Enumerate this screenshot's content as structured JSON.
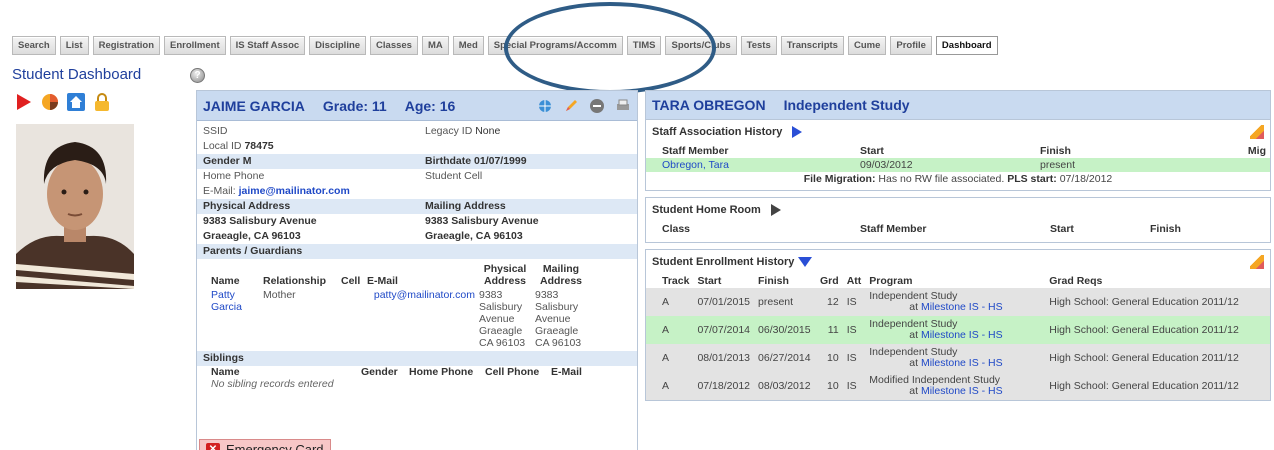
{
  "tabs": [
    {
      "label": "Search"
    },
    {
      "label": "List"
    },
    {
      "label": "Registration"
    },
    {
      "label": "Enrollment"
    },
    {
      "label": "IS Staff Assoc"
    },
    {
      "label": "Discipline"
    },
    {
      "label": "Classes"
    },
    {
      "label": "MA"
    },
    {
      "label": "Med"
    },
    {
      "label": "Special Programs/Accomm"
    },
    {
      "label": "TIMS"
    },
    {
      "label": "Sports/Clubs"
    },
    {
      "label": "Tests"
    },
    {
      "label": "Transcripts"
    },
    {
      "label": "Cume"
    },
    {
      "label": "Profile"
    },
    {
      "label": "Dashboard",
      "active": true
    }
  ],
  "page": {
    "title": "Student Dashboard"
  },
  "student": {
    "name": "JAIME GARCIA",
    "grade": "Grade: 11",
    "age": "Age: 16",
    "ssid_label": "SSID",
    "legacy_label": "Legacy ID",
    "legacy_value": "None",
    "local_label": "Local ID",
    "local_value": "78475",
    "gender_label": "Gender",
    "gender_value": "M",
    "birth_label": "Birthdate",
    "birth_value": "01/07/1999",
    "home_phone_label": "Home Phone",
    "cell_label": "Student Cell",
    "email_label": "E-Mail:",
    "email_value": "jaime@mailinator.com",
    "physical_label": "Physical Address",
    "mailing_label": "Mailing Address",
    "physical_line1": "9383 Salisbury Avenue",
    "physical_line2": "Graeagle, CA 96103",
    "mailing_line1": "9383 Salisbury Avenue",
    "mailing_line2": "Graeagle, CA 96103",
    "parents_label": "Parents / Guardians",
    "guardian_headers": {
      "name": "Name",
      "relationship": "Relationship",
      "cell": "Cell",
      "email": "E-Mail",
      "physical": "Physical Address",
      "mailing": "Mailing Address"
    },
    "guardian": {
      "name": "Patty Garcia",
      "relationship": "Mother",
      "email": "patty@mailinator.com",
      "physical": "9383 Salisbury Avenue Graeagle CA 96103",
      "mailing": "9383 Salisbury Avenue Graeagle CA 96103"
    },
    "siblings_label": "Siblings",
    "sibling_headers": {
      "name": "Name",
      "gender": "Gender",
      "home_phone": "Home Phone",
      "cell": "Cell Phone",
      "email": "E-Mail"
    },
    "sibling_empty": "No sibling records entered",
    "emergency_label": "Emergency Card"
  },
  "teacher": {
    "name": "TARA OBREGON",
    "program": "Independent Study"
  },
  "staff_assoc": {
    "title": "Staff Association History",
    "headers": [
      "Staff Member",
      "Start",
      "Finish",
      "Mig"
    ],
    "row": {
      "member": "Obregon, Tara",
      "start": "09/03/2012",
      "finish": "present"
    },
    "migration_label": "File Migration:",
    "migration_text": "Has no RW file associated.",
    "pls_label": "PLS start:",
    "pls_value": "07/18/2012"
  },
  "home_room": {
    "title": "Student Home Room",
    "headers": [
      "Class",
      "Staff Member",
      "Start",
      "Finish"
    ]
  },
  "enrollment": {
    "title": "Student Enrollment History",
    "headers": [
      "Track",
      "Start",
      "Finish",
      "Grd",
      "Att",
      "Program",
      "Grad Reqs"
    ],
    "rows": [
      {
        "track": "A",
        "start": "07/01/2015",
        "finish": "present",
        "grd": "12",
        "att": "IS",
        "program": "Independent Study",
        "at": "at",
        "school": "Milestone IS - HS",
        "reqs": "High School: General Education 2011/12",
        "style": "grey"
      },
      {
        "track": "A",
        "start": "07/07/2014",
        "finish": "06/30/2015",
        "grd": "11",
        "att": "IS",
        "program": "Independent Study",
        "at": "at",
        "school": "Milestone IS - HS",
        "reqs": "High School: General Education 2011/12",
        "style": "green"
      },
      {
        "track": "A",
        "start": "08/01/2013",
        "finish": "06/27/2014",
        "grd": "10",
        "att": "IS",
        "program": "Independent Study",
        "at": "at",
        "school": "Milestone IS - HS",
        "reqs": "High School: General Education 2011/12",
        "style": "grey"
      },
      {
        "track": "A",
        "start": "07/18/2012",
        "finish": "08/03/2012",
        "grd": "10",
        "att": "IS",
        "program": "Modified Independent Study",
        "at": "at",
        "school": "Milestone IS - HS",
        "reqs": "High School: General Education 2011/12",
        "style": "grey"
      }
    ]
  }
}
